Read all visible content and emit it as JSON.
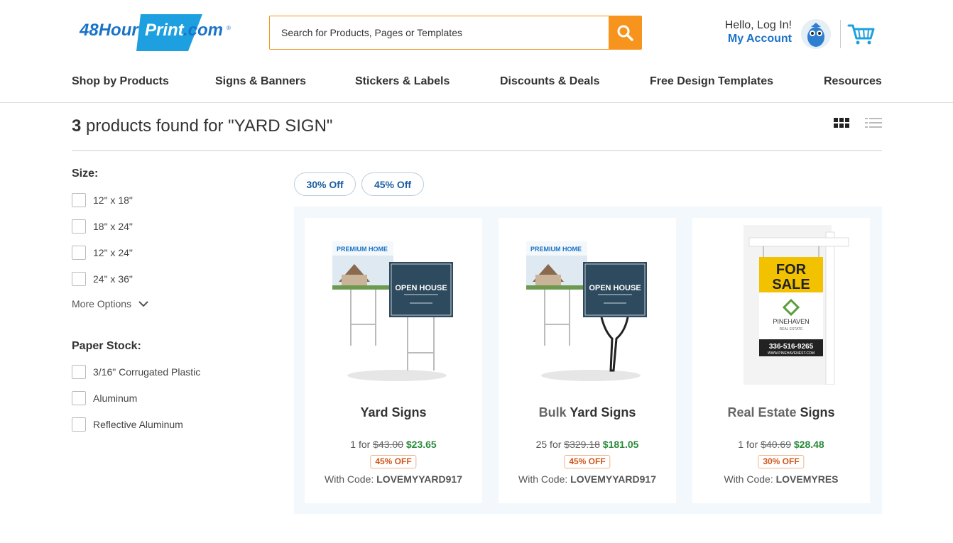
{
  "header": {
    "logo_text": "48HourPrint.com",
    "search_placeholder": "Search for Products, Pages or Templates",
    "greeting": "Hello, Log In!",
    "account_link": "My Account",
    "accent_color": "#f7941d",
    "brand_color": "#1a73c7"
  },
  "nav": [
    "Shop by Products",
    "Signs & Banners",
    "Stickers & Labels",
    "Discounts & Deals",
    "Free Design Templates",
    "Resources"
  ],
  "results": {
    "count": "3",
    "text": " products found for \"YARD SIGN\""
  },
  "filters": {
    "size_title": "Size:",
    "sizes": [
      "12\" x 18\"",
      "18\" x 24\"",
      "12\" x 24\"",
      "24\" x 36\""
    ],
    "more_options": "More Options",
    "stock_title": "Paper Stock:",
    "stocks": [
      "3/16\" Corrugated Plastic",
      "Aluminum",
      "Reflective Aluminum"
    ]
  },
  "chips": [
    "30% Off",
    "45% Off"
  ],
  "products": [
    {
      "name_light": "",
      "name": "Yard Signs",
      "qty": "1 for",
      "old_price": "$43.00",
      "new_price": "$23.65",
      "badge": "45% OFF",
      "code_label": "With Code:",
      "code": "LOVEMYYARD917",
      "image": "yard-sign-image"
    },
    {
      "name_light": "Bulk",
      "name": "Yard Signs",
      "qty": "25 for",
      "old_price": "$329.18",
      "new_price": "$181.05",
      "badge": "45% OFF",
      "code_label": "With Code:",
      "code": "LOVEMYYARD917",
      "image": "bulk-yard-sign-image"
    },
    {
      "name_light": "Real Estate",
      "name": "Signs",
      "qty": "1 for",
      "old_price": "$40.69",
      "new_price": "$28.48",
      "badge": "30% OFF",
      "code_label": "With Code:",
      "code": "LOVEMYRES",
      "image": "real-estate-sign-image"
    }
  ],
  "sign_art": {
    "premium_home": "PREMIUM HOME",
    "open_house": "OPEN HOUSE",
    "for": "FOR",
    "sale": "SALE",
    "brand": "PINEHAVEN",
    "brand_sub": "REAL ESTATE",
    "phone": "336-516-9265",
    "site": "WWW.PINEHAVENEST.COM"
  }
}
